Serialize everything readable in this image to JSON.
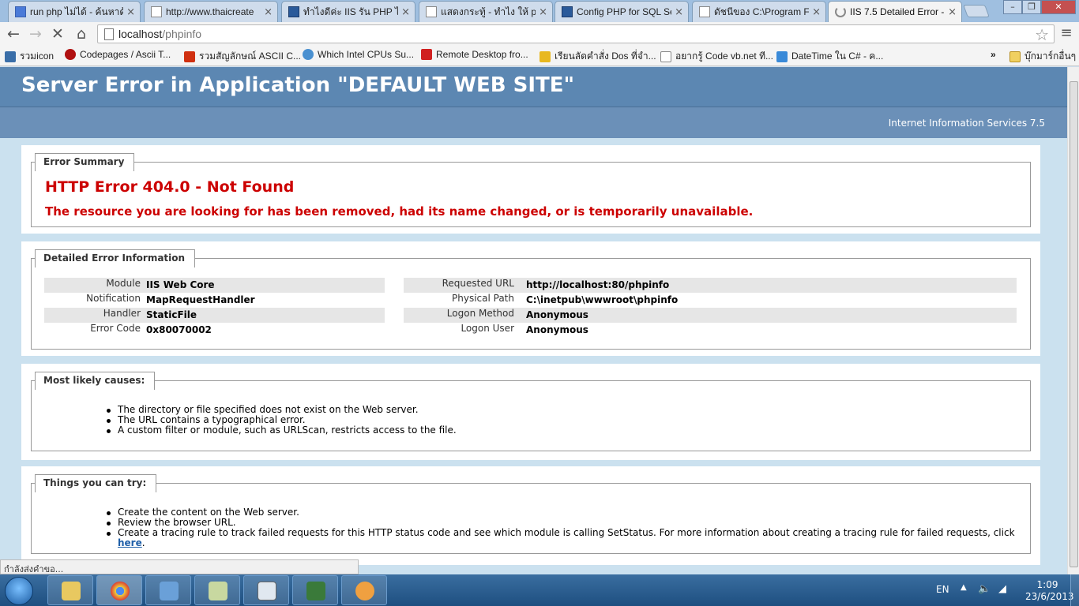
{
  "tabs": [
    {
      "title": "run php ไม่ได้ - ค้นหาด้",
      "close": "×"
    },
    {
      "title": "http://www.thaicreate",
      "close": "×"
    },
    {
      "title": "ทำไงดีค่ะ IIS รัน PHP ไม่",
      "close": "×"
    },
    {
      "title": "แสดงกระทู้ - ทำไง ให้ ph",
      "close": "×"
    },
    {
      "title": "Config PHP for SQL Se",
      "close": "×"
    },
    {
      "title": "ดัชนีของ C:\\Program Fi",
      "close": "×"
    },
    {
      "title": "IIS 7.5 Detailed Error - 4",
      "close": "×"
    }
  ],
  "address": {
    "host": "localhost",
    "path": "/phpinfo"
  },
  "bookmarks": [
    {
      "label": "รวมicon",
      "color": "#3a6ea8"
    },
    {
      "label": "Codepages / Ascii T...",
      "color": "#b01010"
    },
    {
      "label": "รวมสัญลักษณ์ ASCII C...",
      "color": "#d03010"
    },
    {
      "label": "Which Intel CPUs Su...",
      "color": "#4a90d0"
    },
    {
      "label": "Remote Desktop fro...",
      "color": "#d02020"
    },
    {
      "label": "เรียนลัดคำสั่ง Dos ที่จำ...",
      "color": "#e8b820"
    },
    {
      "label": "อยากรู้ Code vb.net ที...",
      "color": "#ffffff"
    },
    {
      "label": "DateTime ใน C# - ค...",
      "color": "#3a8ad8"
    }
  ],
  "bookmarks_overflow": "»",
  "other_bookmarks": "บุ๊กมาร์กอื่นๆ",
  "header": {
    "title": "Server Error in Application \"DEFAULT WEB SITE\"",
    "subtitle": "Internet Information Services 7.5"
  },
  "summary": {
    "legend": "Error Summary",
    "title": "HTTP Error 404.0 - Not Found",
    "description": "The resource you are looking for has been removed, had its name changed, or is temporarily unavailable."
  },
  "details": {
    "legend": "Detailed Error Information",
    "left": [
      {
        "key": "Module",
        "value": "IIS Web Core"
      },
      {
        "key": "Notification",
        "value": "MapRequestHandler"
      },
      {
        "key": "Handler",
        "value": "StaticFile"
      },
      {
        "key": "Error Code",
        "value": "0x80070002"
      }
    ],
    "right": [
      {
        "key": "Requested URL",
        "value": "http://localhost:80/phpinfo"
      },
      {
        "key": "Physical Path",
        "value": "C:\\inetpub\\wwwroot\\phpinfo"
      },
      {
        "key": "Logon Method",
        "value": "Anonymous"
      },
      {
        "key": "Logon User",
        "value": "Anonymous"
      }
    ]
  },
  "causes": {
    "legend": "Most likely causes:",
    "items": [
      "The directory or file specified does not exist on the Web server.",
      "The URL contains a typographical error.",
      "A custom filter or module, such as URLScan, restricts access to the file."
    ]
  },
  "try": {
    "legend": "Things you can try:",
    "items": [
      "Create the content on the Web server.",
      "Review the browser URL."
    ],
    "last_item": "Create a tracing rule to track failed requests for this HTTP status code and see which module is calling SetStatus. For more information about creating a tracing rule for failed requests, click ",
    "link": "here",
    "after_link": "."
  },
  "status": "กำลังส่งคำขอ...",
  "tray": {
    "lang": "EN",
    "time": "1:09",
    "date": "23/6/2013"
  }
}
